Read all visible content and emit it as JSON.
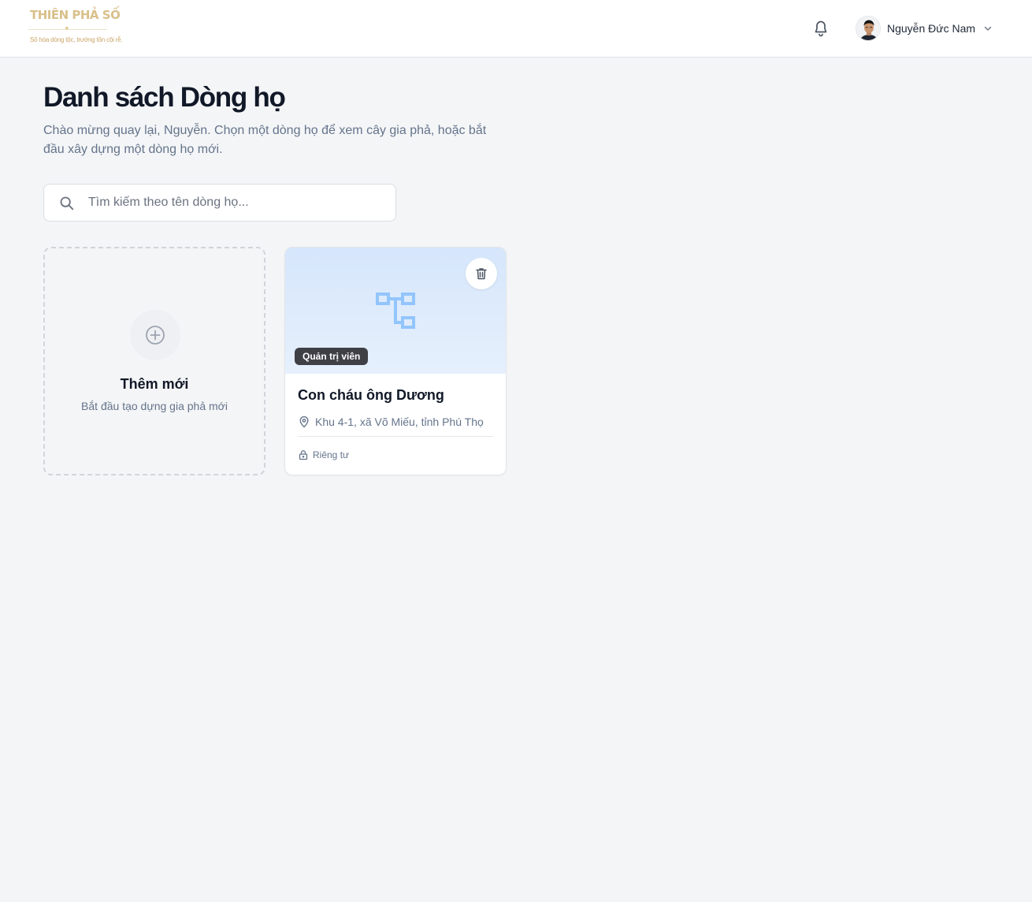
{
  "header": {
    "logo": {
      "name": "THIÊN PHẢ SỐ",
      "tagline": "Số hóa dòng tộc, trường tồn cội rễ."
    },
    "user": {
      "name": "Nguyễn Đức Nam"
    }
  },
  "page": {
    "title": "Danh sách Dòng họ",
    "subtitle": "Chào mừng quay lại, Nguyễn. Chọn một dòng họ để xem cây gia phả, hoặc bắt đầu xây dựng một dòng họ mới."
  },
  "search": {
    "placeholder": "Tìm kiếm theo tên dòng họ...",
    "value": ""
  },
  "add_card": {
    "title": "Thêm mới",
    "subtitle": "Bắt đầu tạo dựng gia phả mới"
  },
  "families": [
    {
      "name": "Con cháu ông Dương",
      "address": "Khu 4-1, xã Võ Miếu, tỉnh Phú Thọ",
      "role": "Quản trị viên",
      "privacy": "Riêng tư"
    }
  ],
  "colors": {
    "brand_gold": "#d9bf8a",
    "cover_blue": "#d6e6fb",
    "tree_icon": "#93c5fd",
    "badge_dark": "#3f3f46"
  },
  "icons": [
    "bell-icon",
    "chevron-down-icon",
    "search-icon",
    "plus-circle-icon",
    "family-tree-icon",
    "trash-icon",
    "map-pin-icon",
    "lock-icon"
  ]
}
